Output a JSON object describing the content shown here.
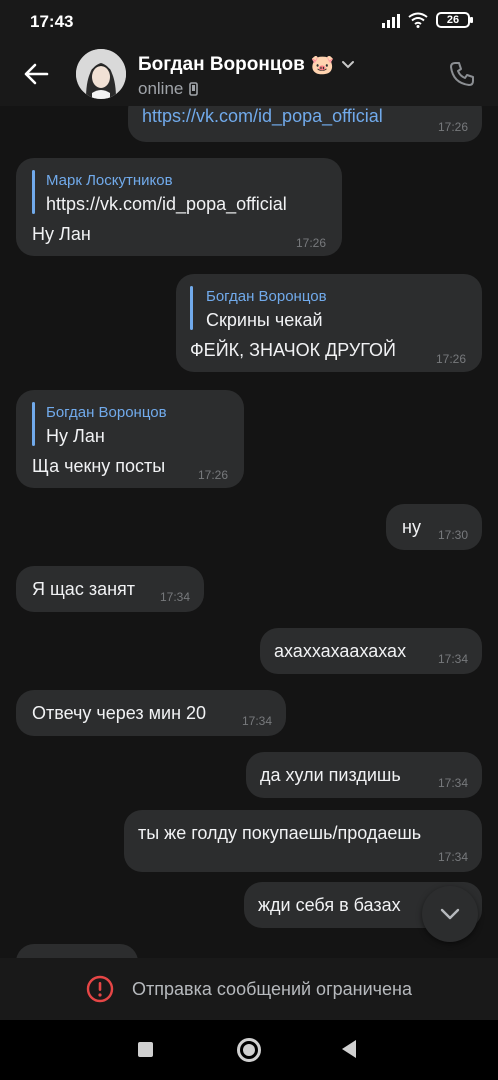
{
  "status_bar": {
    "time": "17:43",
    "battery": "26"
  },
  "header": {
    "name": "Богдан Воронцов",
    "emoji": "🐷",
    "status": "online"
  },
  "messages": [
    {
      "text": "https://vk.com/id_popa_official",
      "time": "17:26"
    },
    {
      "reply_name": "Марк Лоскутников",
      "reply_text": "https://vk.com/id_popa_official",
      "text": "Ну Лан",
      "time": "17:26"
    },
    {
      "reply_name": "Богдан Воронцов",
      "reply_text": "Скрины чекай",
      "text": "ФЕЙК, ЗНАЧОК ДРУГОЙ",
      "time": "17:26"
    },
    {
      "reply_name": "Богдан Воронцов",
      "reply_text": "Ну Лан",
      "text": "Ща чекну посты",
      "time": "17:26"
    },
    {
      "text": "ну",
      "time": "17:30"
    },
    {
      "text": "Я щас занят",
      "time": "17:34"
    },
    {
      "text": "ахаххахаахахах",
      "time": "17:34"
    },
    {
      "text": "Отвечу через мин 20",
      "time": "17:34"
    },
    {
      "text": "да хули пиздишь",
      "time": "17:34"
    },
    {
      "text": "ты же голду покупаешь/продаешь",
      "time": "17:34"
    },
    {
      "text": "жди себя в базах"
    }
  ],
  "restricted": {
    "text": "Отправка сообщений ограничена"
  },
  "colors": {
    "accent": "#71aaeb",
    "bubble": "#2c2d2e",
    "background": "#141414",
    "warning": "#e64646"
  }
}
